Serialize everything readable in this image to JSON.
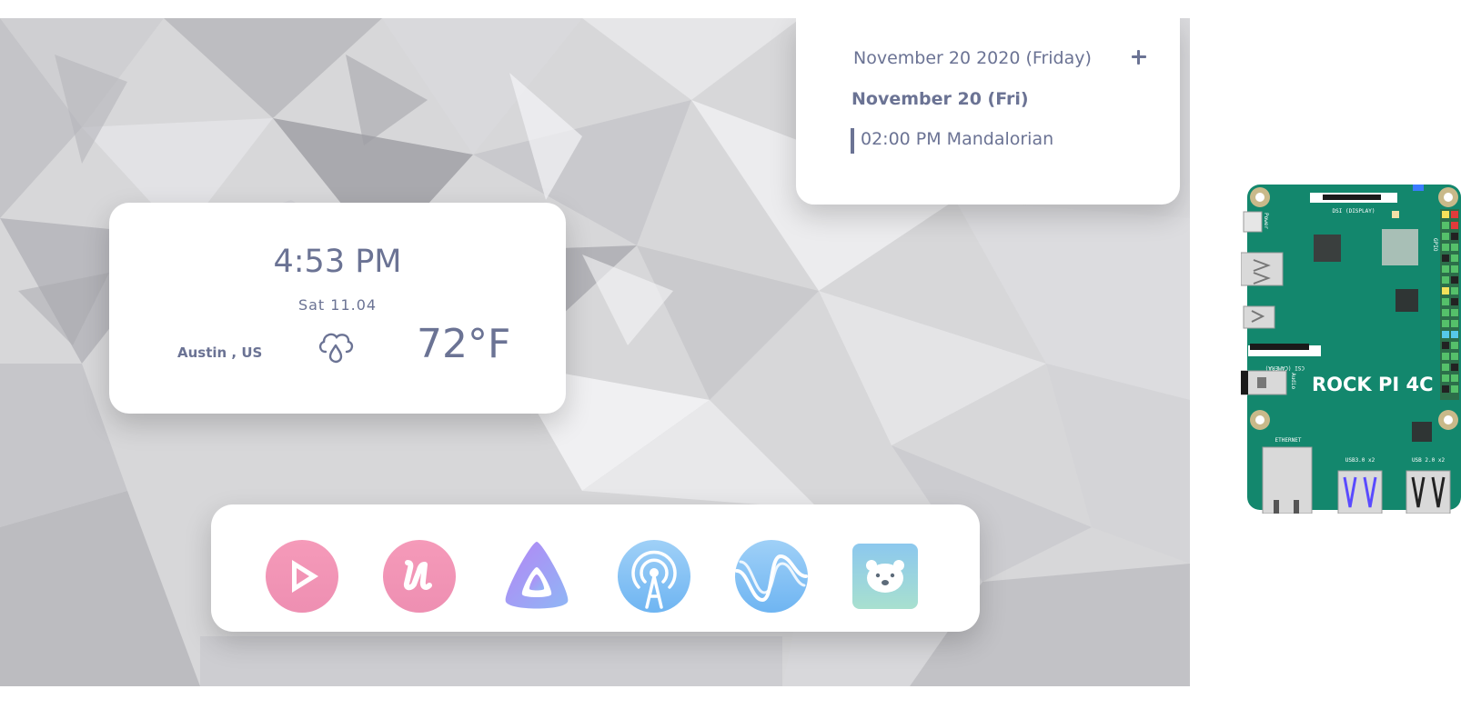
{
  "calendar": {
    "header_date": "November 20 2020 (Friday)",
    "add_icon": "plus-icon",
    "day_label": "November 20  (Fri)",
    "events": [
      {
        "time": "02:00 PM",
        "title": "Mandalorian",
        "text": "02:00 PM  Mandalorian"
      }
    ]
  },
  "clock": {
    "time": "4:53 PM",
    "date": "Sat 11.04",
    "location": "Austin , US",
    "weather_icon": "cloud-rain-icon",
    "temperature": "72°F"
  },
  "dock": {
    "apps": [
      {
        "icon": "play-app-icon",
        "color": "#f08fb0"
      },
      {
        "icon": "u-app-icon",
        "color": "#f08fb0"
      },
      {
        "icon": "jellyfin-app-icon",
        "color": "#a78bfa"
      },
      {
        "icon": "podcast-app-icon",
        "color": "#7cc1f5"
      },
      {
        "icon": "wave-app-icon",
        "color": "#7cc1f5"
      },
      {
        "icon": "bear-app-icon",
        "color": "#8fd3c8"
      }
    ]
  },
  "board": {
    "name": "ROCK PI 4C",
    "labels": {
      "dsi": "DSI (DISPLAY)",
      "power": "Power",
      "gpio": "GPIO",
      "csi": "CSI (CAMERA)",
      "audio": "Audio",
      "ethernet": "ETHERNET",
      "usb3": "USB3.0 x2",
      "usb2": "USB 2.0 x2"
    },
    "pcb_color": "#13876d"
  },
  "colors": {
    "text": "#6b7394",
    "card": "#ffffff"
  }
}
